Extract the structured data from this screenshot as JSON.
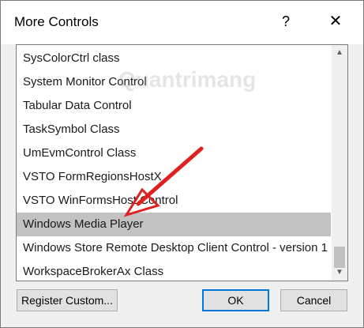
{
  "dialog": {
    "title": "More Controls",
    "help_label": "?",
    "close_label": "✕"
  },
  "listbox": {
    "items": [
      {
        "label": "SysColorCtrl class"
      },
      {
        "label": "System Monitor Control"
      },
      {
        "label": "Tabular Data Control"
      },
      {
        "label": "TaskSymbol Class"
      },
      {
        "label": "UmEvmControl Class"
      },
      {
        "label": "VSTO FormRegionsHostX"
      },
      {
        "label": "VSTO WinFormsHost Control"
      },
      {
        "label": "Windows Media Player"
      },
      {
        "label": "Windows Store Remote Desktop Client Control - version 1"
      },
      {
        "label": "WorkspaceBrokerAx Class"
      }
    ],
    "selected_label": "Windows Media Player"
  },
  "scrollbar": {
    "up_icon": "chevron-up-icon",
    "down_icon": "chevron-down-icon"
  },
  "buttons": {
    "register": "Register Custom...",
    "ok": "OK",
    "cancel": "Cancel"
  },
  "watermark": "Quantrimang",
  "colors": {
    "selection": "#c2c2c2",
    "ok_border": "#0078d7",
    "annotation_arrow": "#e02020"
  }
}
